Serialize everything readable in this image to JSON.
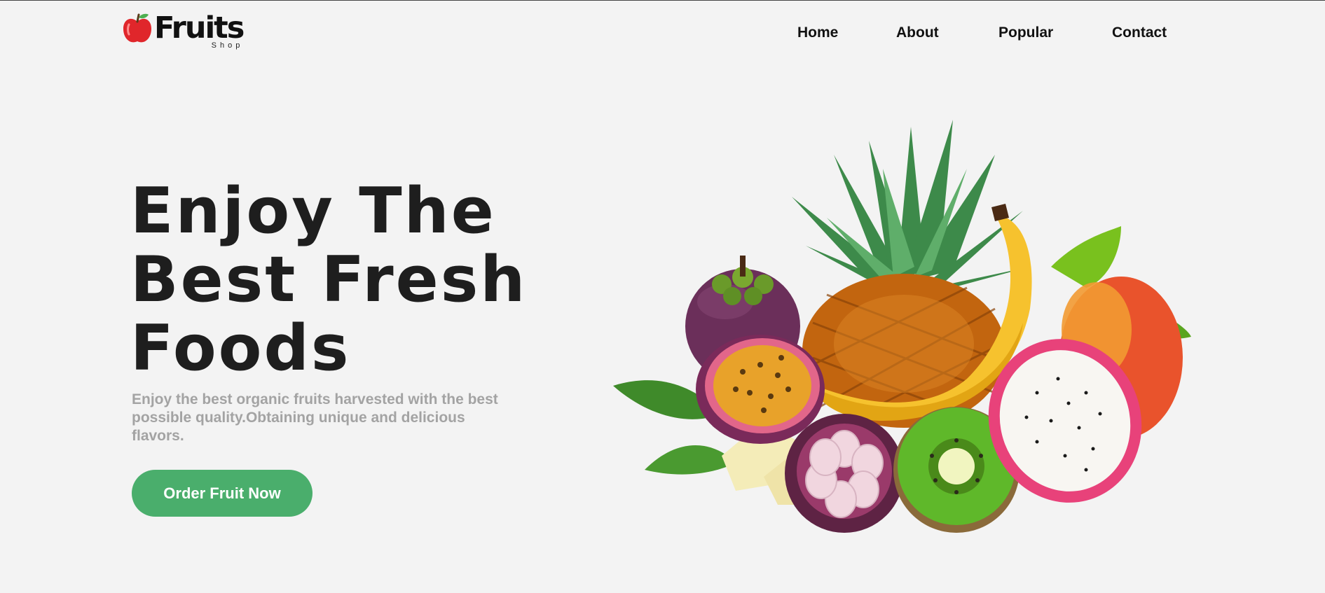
{
  "brand": {
    "name": "Fruits",
    "subtitle": "Shop"
  },
  "nav": {
    "items": [
      "Home",
      "About",
      "Popular",
      "Contact"
    ]
  },
  "hero": {
    "title_lines": [
      "Enjoy The",
      "Best Fresh",
      "Foods"
    ],
    "description": "Enjoy the best organic fruits harvested with the best possible quality.Obtaining unique and delicious flavors.",
    "cta_label": "Order Fruit Now"
  },
  "colors": {
    "background": "#f3f3f3",
    "accent": "#4aae6c",
    "text": "#1e1e1e",
    "muted": "#a3a3a3"
  },
  "icons": {
    "logo": "apple-icon"
  }
}
